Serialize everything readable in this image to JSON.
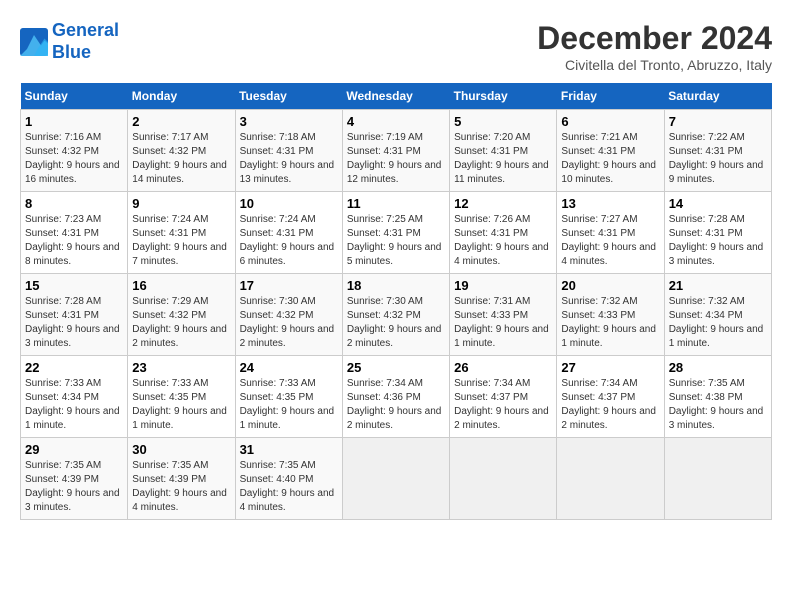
{
  "logo": {
    "line1": "General",
    "line2": "Blue"
  },
  "title": "December 2024",
  "location": "Civitella del Tronto, Abruzzo, Italy",
  "weekdays": [
    "Sunday",
    "Monday",
    "Tuesday",
    "Wednesday",
    "Thursday",
    "Friday",
    "Saturday"
  ],
  "weeks": [
    [
      {
        "day": "1",
        "info": "Sunrise: 7:16 AM\nSunset: 4:32 PM\nDaylight: 9 hours and 16 minutes."
      },
      {
        "day": "2",
        "info": "Sunrise: 7:17 AM\nSunset: 4:32 PM\nDaylight: 9 hours and 14 minutes."
      },
      {
        "day": "3",
        "info": "Sunrise: 7:18 AM\nSunset: 4:31 PM\nDaylight: 9 hours and 13 minutes."
      },
      {
        "day": "4",
        "info": "Sunrise: 7:19 AM\nSunset: 4:31 PM\nDaylight: 9 hours and 12 minutes."
      },
      {
        "day": "5",
        "info": "Sunrise: 7:20 AM\nSunset: 4:31 PM\nDaylight: 9 hours and 11 minutes."
      },
      {
        "day": "6",
        "info": "Sunrise: 7:21 AM\nSunset: 4:31 PM\nDaylight: 9 hours and 10 minutes."
      },
      {
        "day": "7",
        "info": "Sunrise: 7:22 AM\nSunset: 4:31 PM\nDaylight: 9 hours and 9 minutes."
      }
    ],
    [
      {
        "day": "8",
        "info": "Sunrise: 7:23 AM\nSunset: 4:31 PM\nDaylight: 9 hours and 8 minutes."
      },
      {
        "day": "9",
        "info": "Sunrise: 7:24 AM\nSunset: 4:31 PM\nDaylight: 9 hours and 7 minutes."
      },
      {
        "day": "10",
        "info": "Sunrise: 7:24 AM\nSunset: 4:31 PM\nDaylight: 9 hours and 6 minutes."
      },
      {
        "day": "11",
        "info": "Sunrise: 7:25 AM\nSunset: 4:31 PM\nDaylight: 9 hours and 5 minutes."
      },
      {
        "day": "12",
        "info": "Sunrise: 7:26 AM\nSunset: 4:31 PM\nDaylight: 9 hours and 4 minutes."
      },
      {
        "day": "13",
        "info": "Sunrise: 7:27 AM\nSunset: 4:31 PM\nDaylight: 9 hours and 4 minutes."
      },
      {
        "day": "14",
        "info": "Sunrise: 7:28 AM\nSunset: 4:31 PM\nDaylight: 9 hours and 3 minutes."
      }
    ],
    [
      {
        "day": "15",
        "info": "Sunrise: 7:28 AM\nSunset: 4:31 PM\nDaylight: 9 hours and 3 minutes."
      },
      {
        "day": "16",
        "info": "Sunrise: 7:29 AM\nSunset: 4:32 PM\nDaylight: 9 hours and 2 minutes."
      },
      {
        "day": "17",
        "info": "Sunrise: 7:30 AM\nSunset: 4:32 PM\nDaylight: 9 hours and 2 minutes."
      },
      {
        "day": "18",
        "info": "Sunrise: 7:30 AM\nSunset: 4:32 PM\nDaylight: 9 hours and 2 minutes."
      },
      {
        "day": "19",
        "info": "Sunrise: 7:31 AM\nSunset: 4:33 PM\nDaylight: 9 hours and 1 minute."
      },
      {
        "day": "20",
        "info": "Sunrise: 7:32 AM\nSunset: 4:33 PM\nDaylight: 9 hours and 1 minute."
      },
      {
        "day": "21",
        "info": "Sunrise: 7:32 AM\nSunset: 4:34 PM\nDaylight: 9 hours and 1 minute."
      }
    ],
    [
      {
        "day": "22",
        "info": "Sunrise: 7:33 AM\nSunset: 4:34 PM\nDaylight: 9 hours and 1 minute."
      },
      {
        "day": "23",
        "info": "Sunrise: 7:33 AM\nSunset: 4:35 PM\nDaylight: 9 hours and 1 minute."
      },
      {
        "day": "24",
        "info": "Sunrise: 7:33 AM\nSunset: 4:35 PM\nDaylight: 9 hours and 1 minute."
      },
      {
        "day": "25",
        "info": "Sunrise: 7:34 AM\nSunset: 4:36 PM\nDaylight: 9 hours and 2 minutes."
      },
      {
        "day": "26",
        "info": "Sunrise: 7:34 AM\nSunset: 4:37 PM\nDaylight: 9 hours and 2 minutes."
      },
      {
        "day": "27",
        "info": "Sunrise: 7:34 AM\nSunset: 4:37 PM\nDaylight: 9 hours and 2 minutes."
      },
      {
        "day": "28",
        "info": "Sunrise: 7:35 AM\nSunset: 4:38 PM\nDaylight: 9 hours and 3 minutes."
      }
    ],
    [
      {
        "day": "29",
        "info": "Sunrise: 7:35 AM\nSunset: 4:39 PM\nDaylight: 9 hours and 3 minutes."
      },
      {
        "day": "30",
        "info": "Sunrise: 7:35 AM\nSunset: 4:39 PM\nDaylight: 9 hours and 4 minutes."
      },
      {
        "day": "31",
        "info": "Sunrise: 7:35 AM\nSunset: 4:40 PM\nDaylight: 9 hours and 4 minutes."
      },
      null,
      null,
      null,
      null
    ]
  ]
}
